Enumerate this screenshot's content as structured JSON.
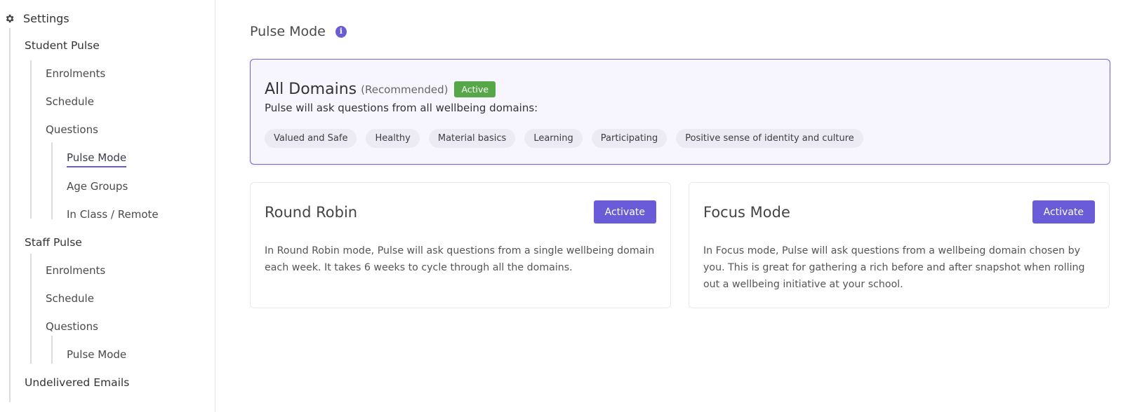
{
  "sidebar": {
    "root": "Settings",
    "student_pulse": {
      "label": "Student Pulse",
      "items": [
        "Enrolments",
        "Schedule",
        "Questions"
      ],
      "question_items": [
        "Pulse Mode",
        "Age Groups",
        "In Class / Remote"
      ]
    },
    "staff_pulse": {
      "label": "Staff Pulse",
      "items": [
        "Enrolments",
        "Schedule",
        "Questions"
      ],
      "question_items": [
        "Pulse Mode"
      ]
    },
    "undelivered": "Undelivered Emails"
  },
  "main": {
    "title": "Pulse Mode",
    "info_icon": "i",
    "featured": {
      "name": "All Domains",
      "recommended": "(Recommended)",
      "badge": "Active",
      "description": "Pulse will ask questions from all wellbeing domains:",
      "domains": [
        "Valued and Safe",
        "Healthy",
        "Material basics",
        "Learning",
        "Participating",
        "Positive sense of identity and culture"
      ]
    },
    "modes": [
      {
        "name": "Round Robin",
        "button": "Activate",
        "description": "In Round Robin mode, Pulse will ask questions from a single wellbeing domain each week. It takes 6 weeks to cycle through all the domains."
      },
      {
        "name": "Focus Mode",
        "button": "Activate",
        "description": "In Focus mode, Pulse will ask questions from a wellbeing domain chosen by you. This is great for gathering a rich before and after snapshot when rolling out a wellbeing initiative at your school."
      }
    ]
  },
  "colors": {
    "accent": "#6a5bd8",
    "active_badge": "#56a747",
    "chip_bg": "#ebeaf5"
  }
}
